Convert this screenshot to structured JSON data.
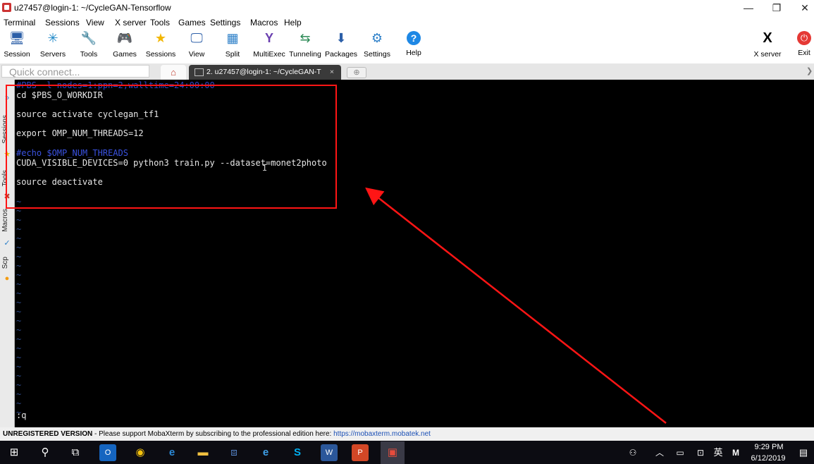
{
  "window": {
    "title": "u27457@login-1: ~/CycleGAN-Tensorflow",
    "minimize": "—",
    "restore": "❐",
    "close": "✕"
  },
  "menu": [
    "Terminal",
    "Sessions",
    "View",
    "X server",
    "Tools",
    "Games",
    "Settings",
    "Macros",
    "Help"
  ],
  "toolbar": {
    "items": [
      {
        "label": "Session",
        "icon": "session-icon",
        "glyph": "🖥"
      },
      {
        "label": "Servers",
        "icon": "servers-icon",
        "glyph": "✳"
      },
      {
        "label": "Tools",
        "icon": "tools-icon",
        "glyph": "🔧"
      },
      {
        "label": "Games",
        "icon": "games-icon",
        "glyph": "🎮"
      },
      {
        "label": "Sessions",
        "icon": "star-icon",
        "glyph": "★"
      },
      {
        "label": "View",
        "icon": "view-icon",
        "glyph": "🖵"
      },
      {
        "label": "Split",
        "icon": "split-icon",
        "glyph": "▦"
      },
      {
        "label": "MultiExec",
        "icon": "multiexec-icon",
        "glyph": "Y"
      },
      {
        "label": "Tunneling",
        "icon": "tunneling-icon",
        "glyph": "⇆"
      },
      {
        "label": "Packages",
        "icon": "packages-icon",
        "glyph": "⬇"
      },
      {
        "label": "Settings",
        "icon": "settings-icon",
        "glyph": "⚙"
      },
      {
        "label": "Help",
        "icon": "help-icon",
        "glyph": "?"
      }
    ],
    "xserver_label": "X server",
    "exit_label": "Exit"
  },
  "tabs": {
    "quick_connect_placeholder": "Quick connect...",
    "active_tab_label": "2. u27457@login-1: ~/CycleGAN-T",
    "close_glyph": "×"
  },
  "sidebar": {
    "sessions": "Sessions",
    "tools": "Tools",
    "macros": "Macros",
    "sftp": "Scp"
  },
  "terminal": {
    "lines": [
      {
        "text": "#PBS -l nodes=1:ppn=2,walltime=24:00:00",
        "color": "#2f45c8"
      },
      {
        "text": "cd $PBS_O_WORKDIR",
        "color": "#e6e6e6"
      },
      {
        "text": "source activate cyclegan_tf1",
        "color": "#e6e6e6"
      },
      {
        "text": "export OMP_NUM_THREADS=12",
        "color": "#e6e6e6"
      },
      {
        "text": "#echo $OMP_NUM_THREADS",
        "color": "#3a52e0"
      },
      {
        "text": "CUDA_VISIBLE_DEVICES=0 python3 train.py --dataset=monet2photo",
        "color": "#e6e6e6"
      },
      {
        "text": "source deactivate",
        "color": "#e6e6e6"
      }
    ],
    "tilde": "~",
    "prompt": ":q"
  },
  "statusbar": {
    "version": "UNREGISTERED VERSION",
    "message": " -  Please support MobaXterm by subscribing to the professional edition here: ",
    "link": "https://mobaxterm.mobatek.net"
  },
  "taskbar": {
    "time": "9:29 PM",
    "date": "6/12/2019",
    "ime": "英",
    "ime_mode": "M"
  },
  "colors": {
    "annotation": "#ff1515",
    "terminal_bg": "#000000"
  }
}
